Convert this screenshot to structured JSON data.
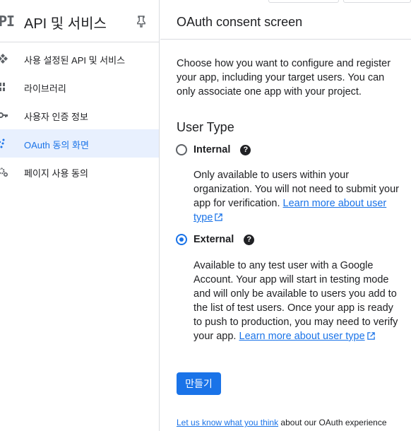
{
  "sidebar": {
    "logo_text": "PI",
    "title": "API 및 서비스",
    "items": [
      {
        "label": "사용 설정된 API 및 서비스",
        "icon": "api-diamond-icon",
        "active": false
      },
      {
        "label": "라이브러리",
        "icon": "library-grid-icon",
        "active": false
      },
      {
        "label": "사용자 인증 정보",
        "icon": "key-icon",
        "active": false
      },
      {
        "label": "OAuth 동의 화면",
        "icon": "consent-icon",
        "active": true
      },
      {
        "label": "페이지 사용 동의",
        "icon": "settings-gear-icon",
        "active": false
      }
    ]
  },
  "main": {
    "title": "OAuth consent screen",
    "intro": "Choose how you want to configure and register your app, including your target users. You can only associate one app with your project.",
    "user_type": {
      "heading": "User Type",
      "internal": {
        "label": "Internal",
        "checked": false,
        "description": "Only available to users within your organization. You will not need to submit your app for verification.",
        "link": "Learn more about user type"
      },
      "external": {
        "label": "External",
        "checked": true,
        "description": "Available to any test user with a Google Account. Your app will start in testing mode and will only be available to users you add to the list of test users. Once your app is ready to push to production, you may need to verify your app.",
        "link": "Learn more about user type"
      }
    },
    "create_button": "만들기",
    "feedback_link": "Let us know what you think",
    "feedback_text": " about our OAuth experience"
  },
  "colors": {
    "accent": "#1a73e8",
    "active_bg": "#e8f0fe",
    "divider": "#dadce0",
    "text": "#202124"
  }
}
